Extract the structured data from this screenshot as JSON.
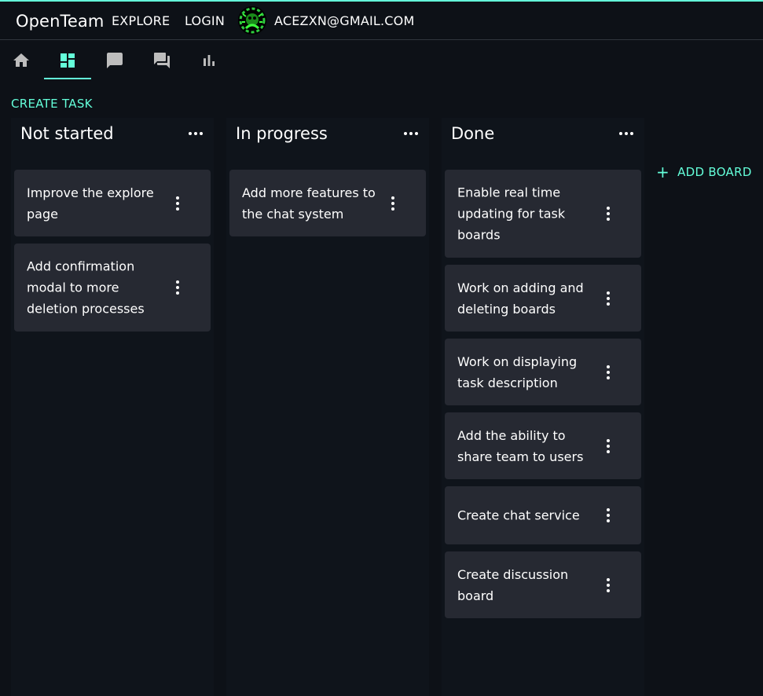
{
  "header": {
    "brand": "OpenTeam",
    "nav": {
      "explore": "EXPLORE",
      "login": "LOGIN"
    },
    "user_email": "ACEZXN@GMAIL.COM"
  },
  "tabs": [
    {
      "icon": "home-icon"
    },
    {
      "icon": "dashboard-icon",
      "active": true
    },
    {
      "icon": "chat-icon"
    },
    {
      "icon": "forum-icon"
    },
    {
      "icon": "bar-chart-icon"
    }
  ],
  "actions": {
    "create_task": "CREATE TASK",
    "add_board": "ADD BOARD",
    "add_board_icon": "+"
  },
  "columns": [
    {
      "title": "Not started",
      "cards": [
        {
          "text": "Improve the explore page"
        },
        {
          "text": "Add confirmation modal to more deletion processes"
        }
      ]
    },
    {
      "title": "In progress",
      "cards": [
        {
          "text": "Add more features to the chat system"
        }
      ]
    },
    {
      "title": "Done",
      "cards": [
        {
          "text": "Enable real time updating for task boards"
        },
        {
          "text": "Work on adding and deleting boards"
        },
        {
          "text": "Work on displaying task description"
        },
        {
          "text": "Add the ability to share team to users"
        },
        {
          "text": "Create chat service"
        },
        {
          "text": "Create discussion board"
        }
      ]
    }
  ],
  "colors": {
    "accent": "#64ffda",
    "background": "#0d1117",
    "column": "#0f141b",
    "card": "#262932",
    "icon_inactive": "#bdbdbd"
  }
}
